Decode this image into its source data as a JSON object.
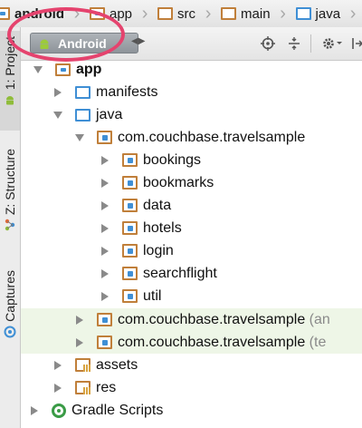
{
  "breadcrumb": {
    "items": [
      {
        "label": "android",
        "icon": "folder-icon"
      },
      {
        "label": "app",
        "icon": "folder-icon"
      },
      {
        "label": "src",
        "icon": "folder-icon"
      },
      {
        "label": "main",
        "icon": "folder-icon"
      },
      {
        "label": "java",
        "icon": "folder-icon"
      }
    ]
  },
  "toolstrip": {
    "tabs": [
      {
        "label": "1: Project",
        "icon": "android-icon"
      },
      {
        "label": "Z: Structure",
        "icon": "structure-icon"
      },
      {
        "label": "Captures",
        "icon": "capture-icon"
      }
    ]
  },
  "toolbar": {
    "view_label": "Android",
    "buttons": [
      "target-icon",
      "collapse-icon",
      "gear-icon",
      "pin-icon"
    ]
  },
  "tree": {
    "rows": [
      {
        "label": "app",
        "suffix": "",
        "arrow": "open",
        "icon": "module-folder"
      },
      {
        "label": "manifests",
        "suffix": "",
        "arrow": "closed",
        "icon": "folder"
      },
      {
        "label": "java",
        "suffix": "",
        "arrow": "open",
        "icon": "folder"
      },
      {
        "label": "com.couchbase.travelsample",
        "suffix": "",
        "arrow": "open",
        "icon": "package"
      },
      {
        "label": "bookings",
        "suffix": "",
        "arrow": "closed",
        "icon": "package"
      },
      {
        "label": "bookmarks",
        "suffix": "",
        "arrow": "closed",
        "icon": "package"
      },
      {
        "label": "data",
        "suffix": "",
        "arrow": "closed",
        "icon": "package"
      },
      {
        "label": "hotels",
        "suffix": "",
        "arrow": "closed",
        "icon": "package"
      },
      {
        "label": "login",
        "suffix": "",
        "arrow": "closed",
        "icon": "package"
      },
      {
        "label": "searchflight",
        "suffix": "",
        "arrow": "closed",
        "icon": "package"
      },
      {
        "label": "util",
        "suffix": "",
        "arrow": "closed",
        "icon": "package"
      },
      {
        "label": "com.couchbase.travelsample",
        "suffix": "(an",
        "arrow": "closed",
        "icon": "package"
      },
      {
        "label": "com.couchbase.travelsample",
        "suffix": "(te",
        "arrow": "closed",
        "icon": "package"
      },
      {
        "label": "assets",
        "suffix": "",
        "arrow": "closed",
        "icon": "resource-folder"
      },
      {
        "label": "res",
        "suffix": "",
        "arrow": "closed",
        "icon": "resource-folder"
      },
      {
        "label": "Gradle Scripts",
        "suffix": "",
        "arrow": "closed",
        "icon": "gradle"
      }
    ]
  },
  "colors": {
    "accent_ring": "#e5436e",
    "folder_blue": "#3f8fd5",
    "folder_brown": "#c07f3a",
    "row_tint": "#eef6e7",
    "android_green": "#8fbc3a"
  }
}
